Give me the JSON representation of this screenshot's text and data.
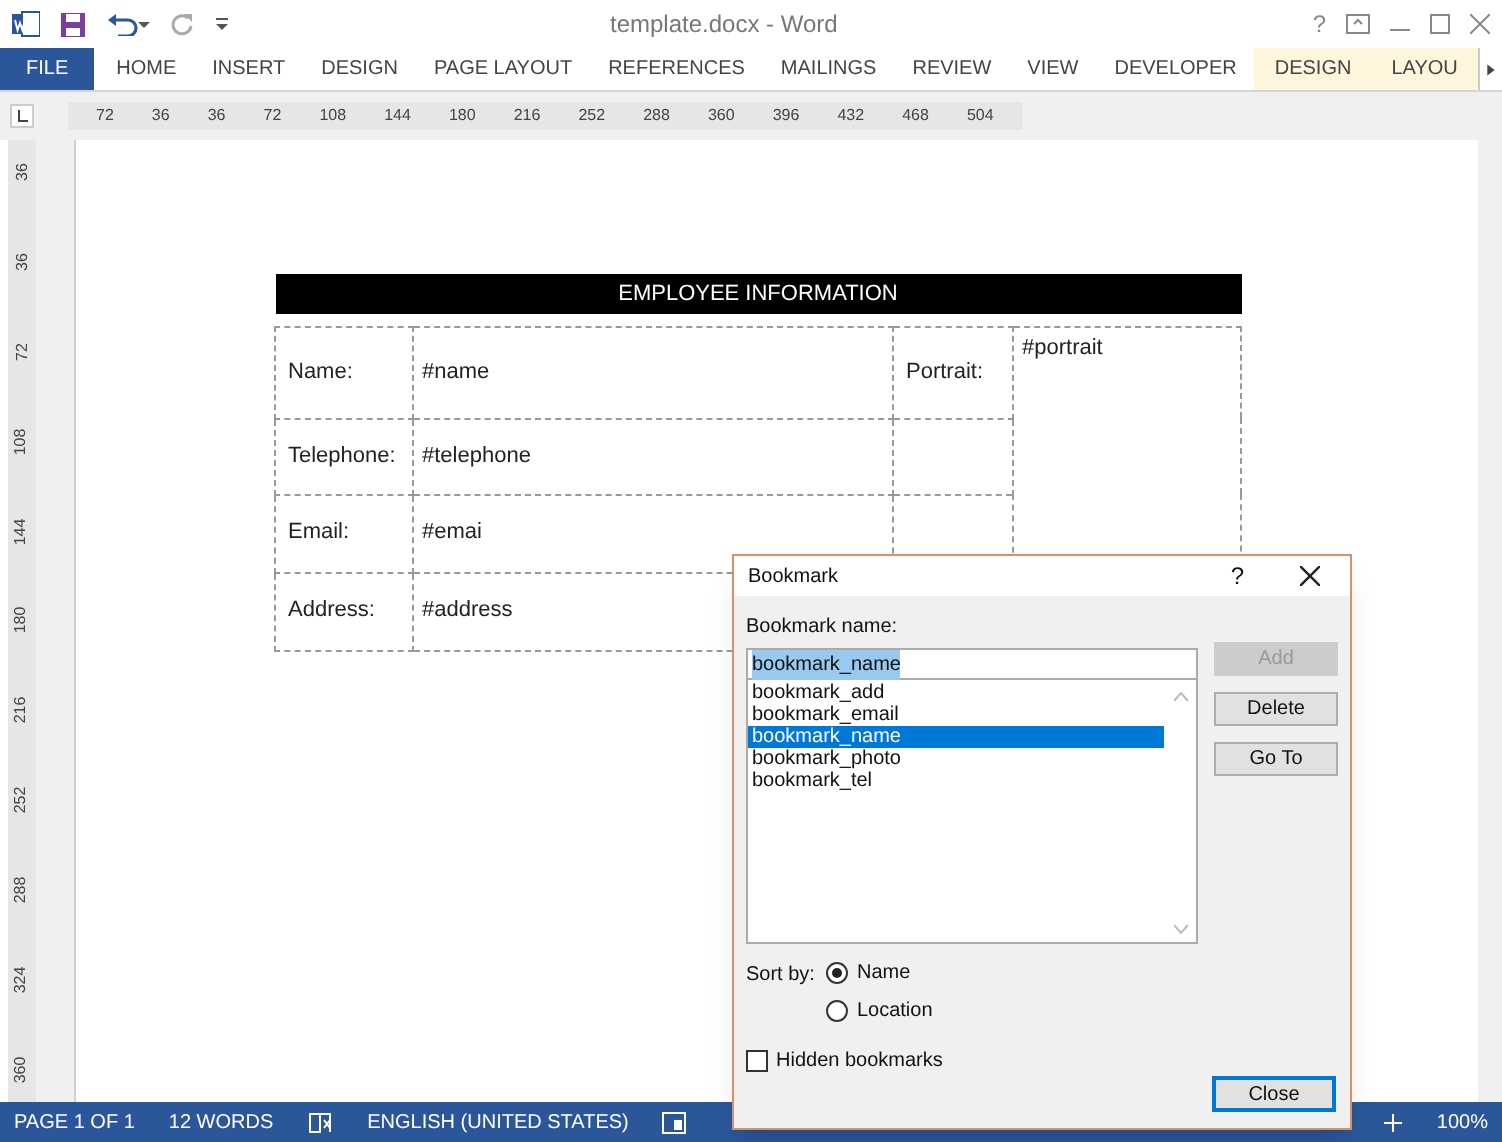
{
  "window": {
    "title": "template.docx - Word",
    "help": "?"
  },
  "ribbon_tabs": [
    {
      "label": "FILE",
      "kind": "file"
    },
    {
      "label": "HOME",
      "kind": "tab"
    },
    {
      "label": "INSERT",
      "kind": "tab"
    },
    {
      "label": "DESIGN",
      "kind": "tab"
    },
    {
      "label": "PAGE LAYOUT",
      "kind": "tab"
    },
    {
      "label": "REFERENCES",
      "kind": "tab"
    },
    {
      "label": "MAILINGS",
      "kind": "tab"
    },
    {
      "label": "REVIEW",
      "kind": "tab"
    },
    {
      "label": "VIEW",
      "kind": "tab"
    },
    {
      "label": "DEVELOPER",
      "kind": "tab"
    },
    {
      "label": "DESIGN",
      "kind": "context"
    },
    {
      "label": "LAYOU",
      "kind": "context"
    }
  ],
  "horizontal_ruler": [
    "72",
    "36",
    "36",
    "72",
    "108",
    "144",
    "180",
    "216",
    "252",
    "288",
    "360",
    "396",
    "432",
    "468",
    "504"
  ],
  "vertical_ruler": [
    "36",
    "36",
    "72",
    "108",
    "144",
    "180",
    "216",
    "252",
    "288",
    "324",
    "360"
  ],
  "table": {
    "header": "EMPLOYEE INFORMATION",
    "rows": [
      {
        "label": "Name:",
        "value": "#name",
        "extra_label": "Portrait:",
        "extra_value": "#portrait"
      },
      {
        "label": "Telephone:",
        "value": "#telephone"
      },
      {
        "label": "Email:",
        "value": "#emai"
      },
      {
        "label": "Address:",
        "value": "#address"
      }
    ]
  },
  "dialog": {
    "title": "Bookmark",
    "help": "?",
    "name_label": "Bookmark name:",
    "name_value": "bookmark_name",
    "bookmarks": [
      {
        "label": "bookmark_add",
        "selected": false
      },
      {
        "label": "bookmark_email",
        "selected": false
      },
      {
        "label": "bookmark_name",
        "selected": true
      },
      {
        "label": "bookmark_photo",
        "selected": false
      },
      {
        "label": "bookmark_tel",
        "selected": false
      }
    ],
    "buttons": [
      {
        "label": "Add",
        "disabled": true
      },
      {
        "label": "Delete",
        "disabled": false
      },
      {
        "label": "Go To",
        "disabled": false
      }
    ],
    "sort_label": "Sort by:",
    "sort_options": [
      {
        "label": "Name",
        "selected": true
      },
      {
        "label": "Location",
        "selected": false
      }
    ],
    "hidden_bookmarks": {
      "label": "Hidden bookmarks",
      "checked": false
    },
    "close": "Close"
  },
  "status_bar": {
    "page": "PAGE 1 OF 1",
    "words": "12 WORDS",
    "language": "ENGLISH (UNITED STATES)",
    "zoom": "100%"
  }
}
